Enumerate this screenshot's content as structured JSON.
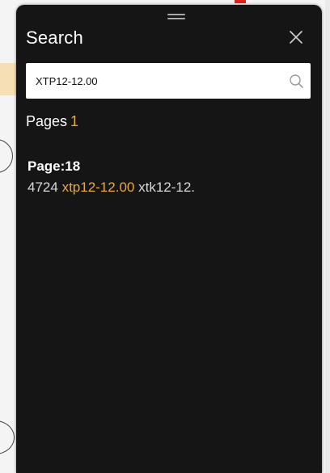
{
  "panel": {
    "title": "Search",
    "close_icon": "close-icon",
    "accent_color": "#e7a93f",
    "background_color": "#151515"
  },
  "search": {
    "value": "XTP12-12.00",
    "placeholder": "",
    "icon": "search-icon"
  },
  "summary": {
    "label": "Pages",
    "count": "1"
  },
  "results": [
    {
      "page_label": "Page:18",
      "snippet_prefix": "4724",
      "snippet_match": "xtp12-12.00",
      "snippet_suffix": "xtk12-12."
    }
  ]
}
